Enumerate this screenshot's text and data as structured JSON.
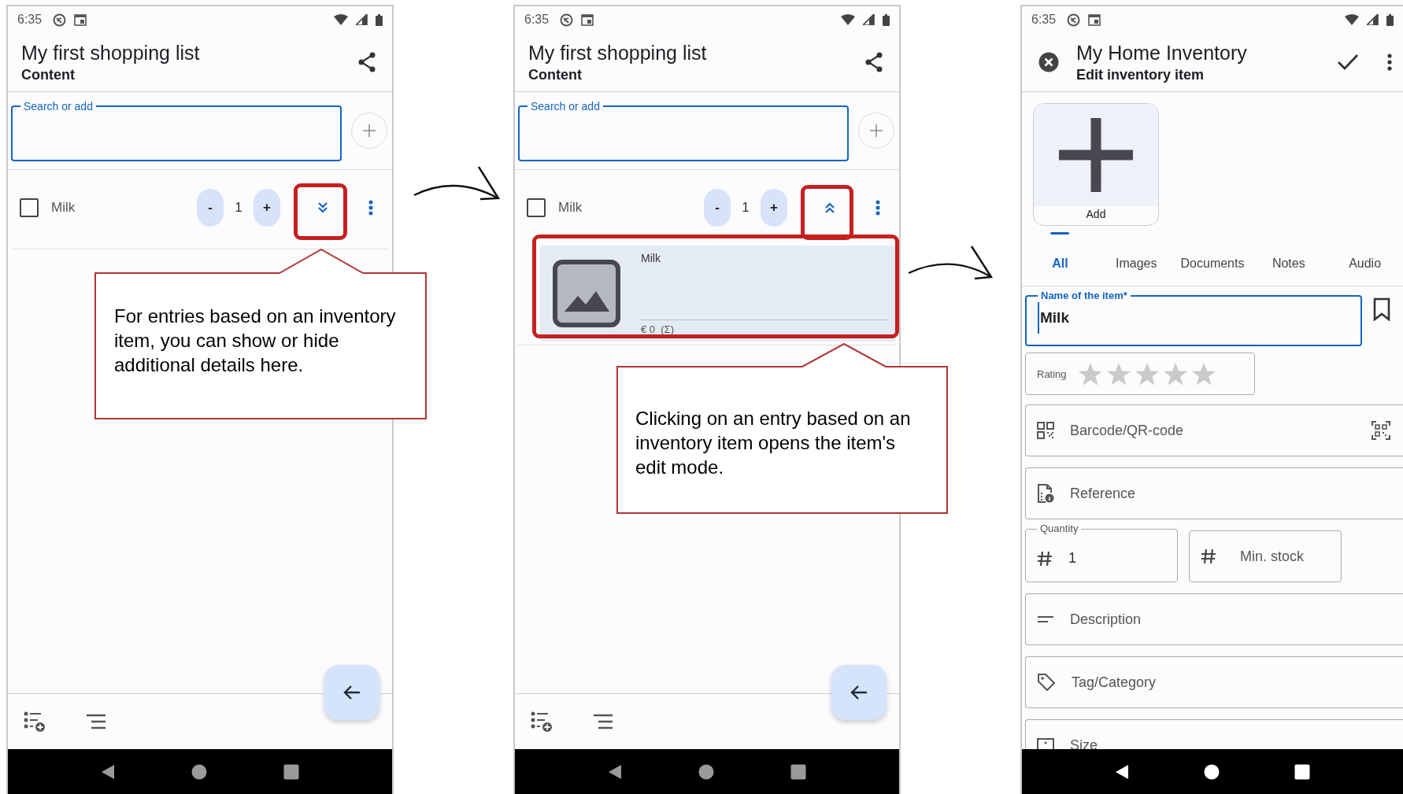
{
  "screens": [
    {
      "kind": "list",
      "status_time": "6:35",
      "title": "My first shopping list",
      "subtitle": "Content",
      "search": {
        "label": "Search or add"
      },
      "items": [
        {
          "checked": false,
          "name": "Milk",
          "minus": "-",
          "quantity": "1",
          "plus": "+",
          "expanded": false
        }
      ]
    },
    {
      "kind": "list",
      "status_time": "6:35",
      "title": "My first shopping list",
      "subtitle": "Content",
      "search": {
        "label": "Search or add"
      },
      "items": [
        {
          "checked": false,
          "name": "Milk",
          "minus": "-",
          "quantity": "1",
          "plus": "+",
          "expanded": true,
          "details": {
            "name": "Milk",
            "price": "€ 0  (Σ)"
          }
        }
      ]
    },
    {
      "kind": "editor",
      "status_time": "6:35",
      "title": "My Home Inventory",
      "subtitle": "Edit inventory item",
      "add_tile": "Add",
      "tabs": [
        {
          "label": "All",
          "selected": true
        },
        {
          "label": "Images",
          "selected": false
        },
        {
          "label": "Documents",
          "selected": false
        },
        {
          "label": "Notes",
          "selected": false
        },
        {
          "label": "Audio",
          "selected": false
        }
      ],
      "name_field": {
        "label": "Name of the item*",
        "value": "Milk"
      },
      "rating": {
        "label": "Rating",
        "stars": 0
      },
      "fields": [
        {
          "kind": "barcode",
          "placeholder": "Barcode/QR-code"
        },
        {
          "kind": "reference",
          "placeholder": "Reference"
        },
        {
          "kind": "quantity",
          "label": "Quantity",
          "value": "1",
          "placeholder": "Min. stock"
        },
        {
          "kind": "description",
          "placeholder": "Description"
        },
        {
          "kind": "tag",
          "placeholder": "Tag/Category"
        },
        {
          "kind": "size",
          "placeholder": "Size"
        }
      ]
    }
  ],
  "callouts": [
    {
      "text": "For entries based on an inventory item, you can show or hide additional details here."
    },
    {
      "text": "Clicking on an entry based on an inventory item opens the item's edit mode."
    }
  ]
}
